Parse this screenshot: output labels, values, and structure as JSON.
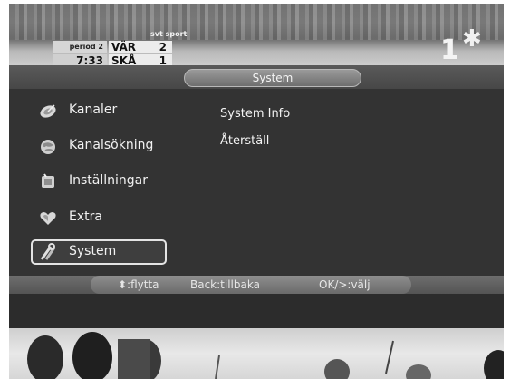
{
  "scoreboard": {
    "channel": "svt sport",
    "period": "period 2",
    "time": "7:33",
    "teams": [
      {
        "name": "VÄR",
        "score": "2"
      },
      {
        "name": "SKÅ",
        "score": "1"
      }
    ]
  },
  "channel_number": "1",
  "menu": {
    "title": "System",
    "items": [
      {
        "label": "Kanaler",
        "icon": "satellite-dish-icon"
      },
      {
        "label": "Kanalsökning",
        "icon": "globe-icon"
      },
      {
        "label": "Inställningar",
        "icon": "settings-box-icon"
      },
      {
        "label": "Extra",
        "icon": "heart-icon"
      },
      {
        "label": "System",
        "icon": "tools-icon",
        "selected": true
      }
    ],
    "submenu": [
      {
        "label": "System Info"
      },
      {
        "label": "Återställ"
      }
    ]
  },
  "help": {
    "move": "⬍:flytta",
    "back": "Back:tillbaka",
    "ok": "OK/>:välj"
  }
}
